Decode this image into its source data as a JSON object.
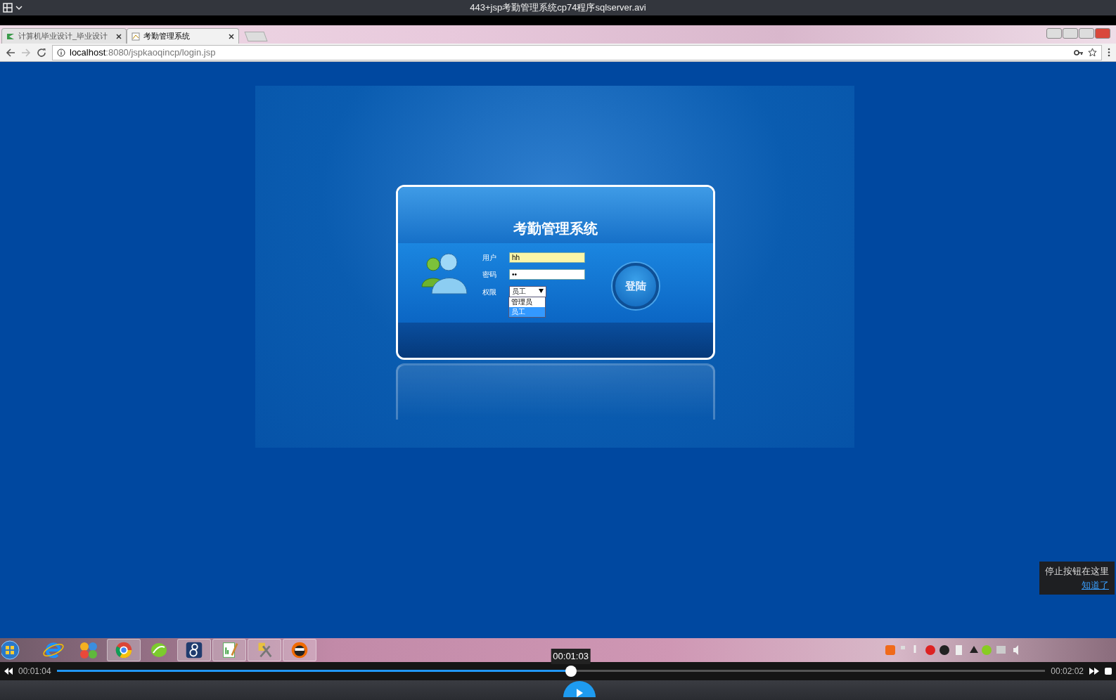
{
  "player": {
    "title": "443+jsp考勤管理系统cp74程序sqlserver.avi",
    "current_time": "00:01:04",
    "total_time": "00:02:02",
    "level": 0.52,
    "hover_time": "00:01:03",
    "tip": {
      "text": "停止按钮在这里",
      "link": "知道了"
    }
  },
  "browser": {
    "tabs": [
      {
        "title": "计算机毕业设计_毕业设计",
        "selected": false
      },
      {
        "title": "考勤管理系统",
        "selected": true
      }
    ],
    "url_host": "localhost",
    "url_path": ":8080/jspkaoqincp/login.jsp"
  },
  "login": {
    "title": "考勤管理系统",
    "fields": [
      {
        "kind": "text",
        "label": "用户",
        "value": "hh",
        "autofilled": true
      },
      {
        "kind": "password",
        "label": "密码",
        "value": "••",
        "autofilled": false
      },
      {
        "kind": "select",
        "label": "权限",
        "value": "员工",
        "options": [
          {
            "label": "管理员",
            "selected": false
          },
          {
            "label": "员工",
            "selected": true
          }
        ]
      }
    ],
    "button": "登陆"
  }
}
